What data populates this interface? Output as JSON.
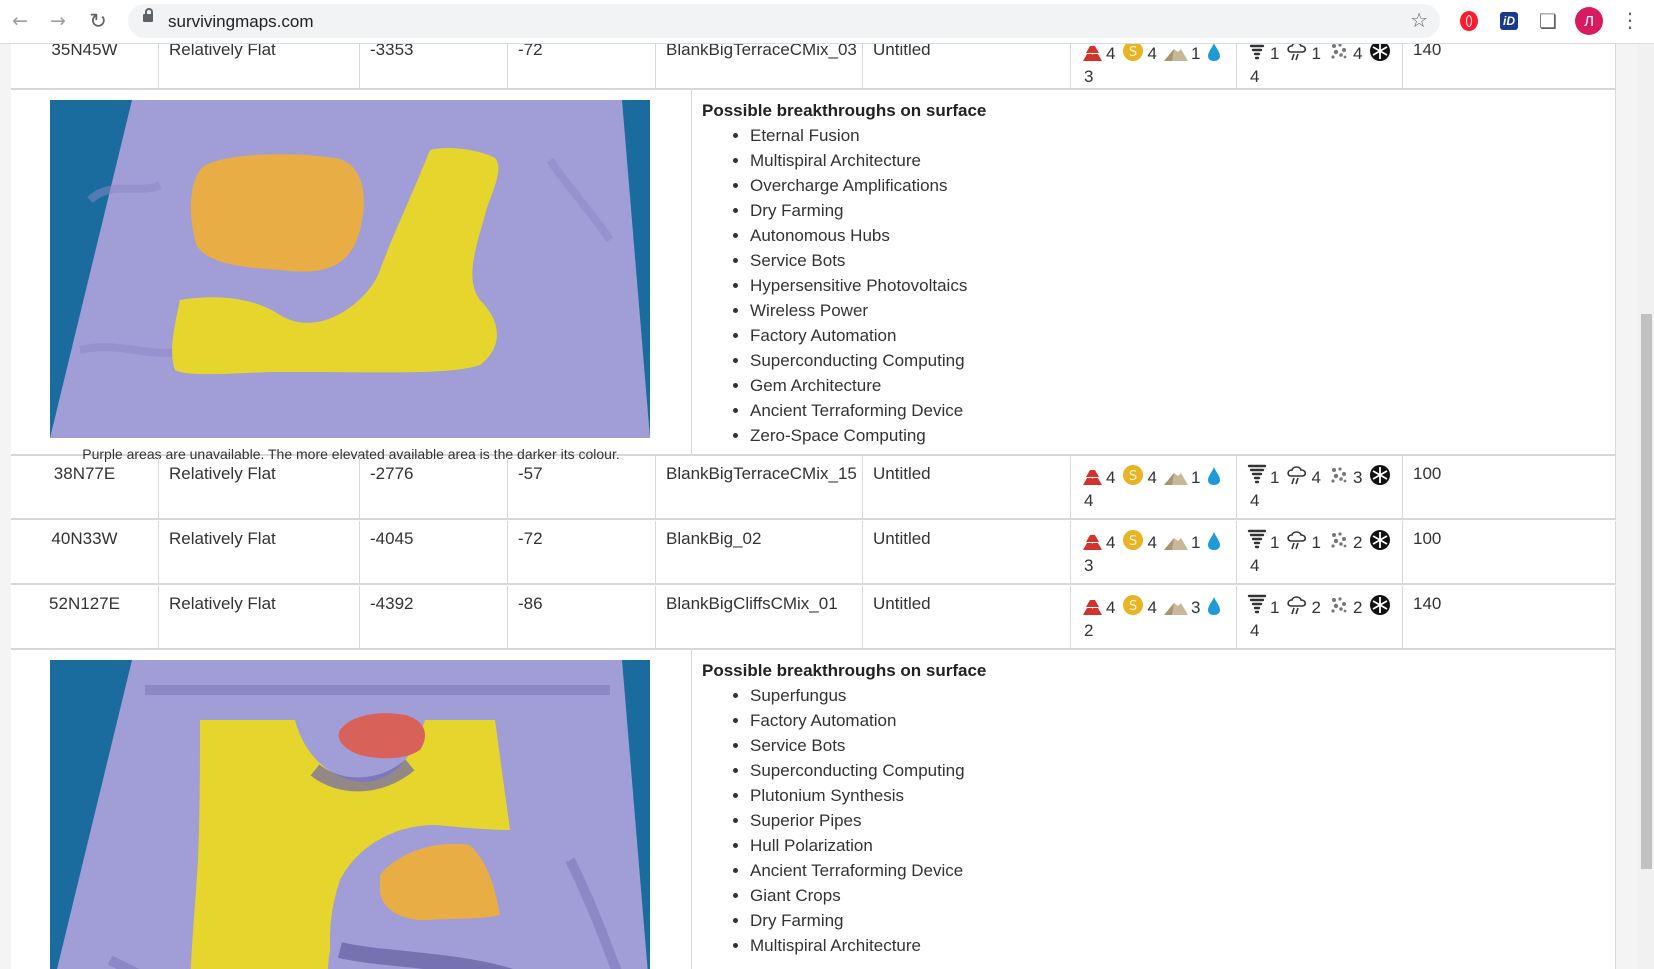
{
  "browser": {
    "url": "survivingmaps.com",
    "avatar_letter": "Л",
    "ext_id_label": "iD"
  },
  "icons": {
    "resource": [
      "metals-icon",
      "precious-metals-icon",
      "concrete-icon",
      "water-icon"
    ],
    "disaster": [
      "dust-devil-icon",
      "dust-storm-icon",
      "meteor-icon",
      "cold-wave-icon"
    ]
  },
  "colors": {
    "metals": "#d0342c",
    "precious": "#e8b324",
    "concrete": "#c8b89a",
    "water": "#1e9bd7",
    "map_bg": "#1a6b9e",
    "map_purple": "#9f9ad6",
    "map_yellow": "#e6d52c",
    "map_orange": "#e9ae43",
    "map_red": "#d8625a"
  },
  "rows": [
    {
      "coords": "35N45W",
      "topography": "Relatively Flat",
      "altitude": "-3353",
      "temperature": "-72",
      "map_name": "BlankBigTerraceCMix_03",
      "named_location": "Untitled",
      "metals": "4",
      "precious_metals": "4",
      "concrete": "1",
      "water": "3",
      "dust_devils": "1",
      "dust_storms": "1",
      "meteors": "4",
      "cold_waves": "4",
      "difficulty": "140"
    },
    {
      "coords": "38N77E",
      "topography": "Relatively Flat",
      "altitude": "-2776",
      "temperature": "-57",
      "map_name": "BlankBigTerraceCMix_15",
      "named_location": "Untitled",
      "metals": "4",
      "precious_metals": "4",
      "concrete": "1",
      "water": "4",
      "dust_devils": "1",
      "dust_storms": "4",
      "meteors": "3",
      "cold_waves": "4",
      "difficulty": "100"
    },
    {
      "coords": "40N33W",
      "topography": "Relatively Flat",
      "altitude": "-4045",
      "temperature": "-72",
      "map_name": "BlankBig_02",
      "named_location": "Untitled",
      "metals": "4",
      "precious_metals": "4",
      "concrete": "1",
      "water": "3",
      "dust_devils": "1",
      "dust_storms": "1",
      "meteors": "2",
      "cold_waves": "4",
      "difficulty": "100"
    },
    {
      "coords": "52N127E",
      "topography": "Relatively Flat",
      "altitude": "-4392",
      "temperature": "-86",
      "map_name": "BlankBigCliffsCMix_01",
      "named_location": "Untitled",
      "metals": "4",
      "precious_metals": "4",
      "concrete": "3",
      "water": "2",
      "dust_devils": "1",
      "dust_storms": "2",
      "meteors": "2",
      "cold_waves": "4",
      "difficulty": "140"
    }
  ],
  "details": [
    {
      "caption": "Purple areas are unavailable. The more elevated available area is the darker its colour.",
      "title": "Possible breakthroughs on surface",
      "items": [
        "Eternal Fusion",
        "Multispiral Architecture",
        "Overcharge Amplifications",
        "Dry Farming",
        "Autonomous Hubs",
        "Service Bots",
        "Hypersensitive Photovoltaics",
        "Wireless Power",
        "Factory Automation",
        "Superconducting Computing",
        "Gem Architecture",
        "Ancient Terraforming Device",
        "Zero-Space Computing"
      ]
    },
    {
      "caption": "",
      "title": "Possible breakthroughs on surface",
      "items": [
        "Superfungus",
        "Factory Automation",
        "Service Bots",
        "Superconducting Computing",
        "Plutonium Synthesis",
        "Superior Pipes",
        "Hull Polarization",
        "Ancient Terraforming Device",
        "Giant Crops",
        "Dry Farming",
        "Multispiral Architecture"
      ]
    }
  ]
}
